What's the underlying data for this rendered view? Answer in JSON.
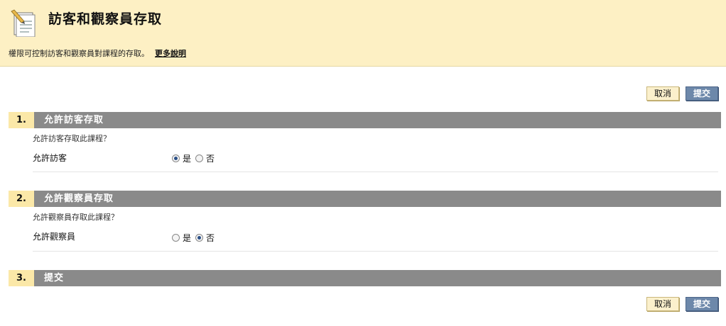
{
  "header": {
    "title": "訪客和觀察員存取",
    "description": "權限可控制訪客和觀察員對課程的存取。",
    "more_help_link": "更多說明",
    "icon": "document-pencil-icon"
  },
  "toolbar": {
    "cancel_label": "取消",
    "submit_label": "提交"
  },
  "steps": [
    {
      "number": "1.",
      "title": "允許訪客存取",
      "instruction": "允許訪客存取此課程？",
      "field_label": "允許訪客",
      "options": [
        {
          "label": "是",
          "checked": true
        },
        {
          "label": "否",
          "checked": false
        }
      ]
    },
    {
      "number": "2.",
      "title": "允許觀察員存取",
      "instruction": "允許觀察員存取此課程？",
      "field_label": "允許觀察員",
      "options": [
        {
          "label": "是",
          "checked": false
        },
        {
          "label": "否",
          "checked": true
        }
      ]
    },
    {
      "number": "3.",
      "title": "提交"
    }
  ]
}
